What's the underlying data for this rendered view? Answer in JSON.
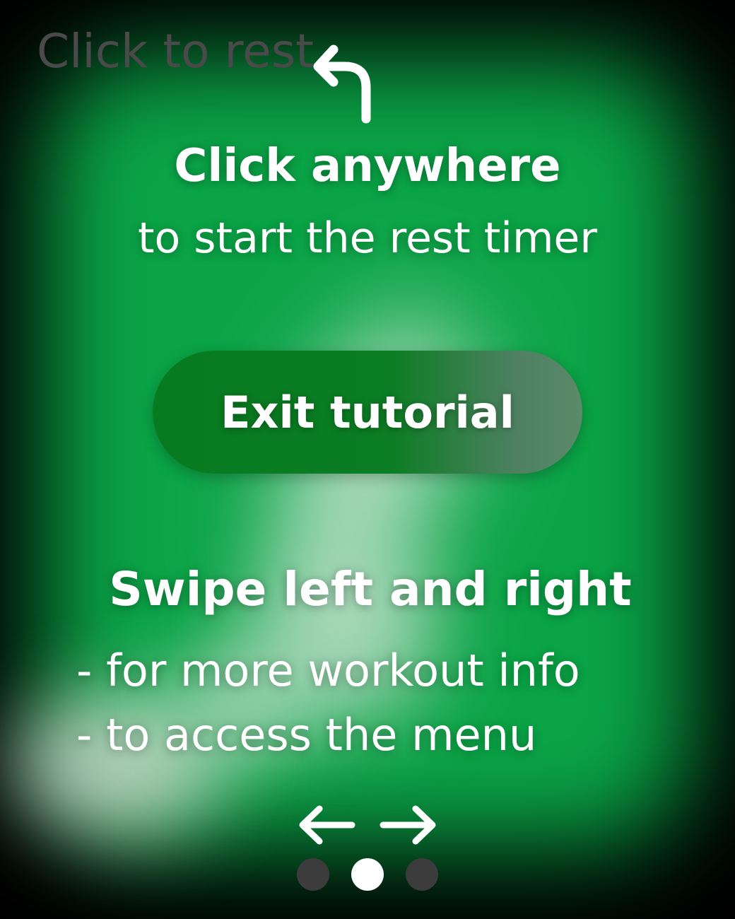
{
  "corner_hint": {
    "label": "Click to rest",
    "icon": "curved-arrow-up-left-icon"
  },
  "instruction_click": {
    "title": "Click anywhere",
    "subtitle": "to start the rest timer"
  },
  "exit_button": {
    "label": "Exit tutorial"
  },
  "instruction_swipe": {
    "title": "Swipe left and right",
    "bullets": [
      "- for more workout info",
      "- to access the menu"
    ],
    "icon_left": "arrow-left-icon",
    "icon_right": "arrow-right-icon"
  },
  "pagination": {
    "total": 3,
    "active_index": 1
  },
  "colors": {
    "background": "#000000",
    "glow_green": "#0aa446",
    "button_green": "#087a20",
    "hint_gray": "#4a4a4a",
    "dot_inactive": "#3c3c3c",
    "dot_active": "#ffffff",
    "text": "#ffffff"
  }
}
